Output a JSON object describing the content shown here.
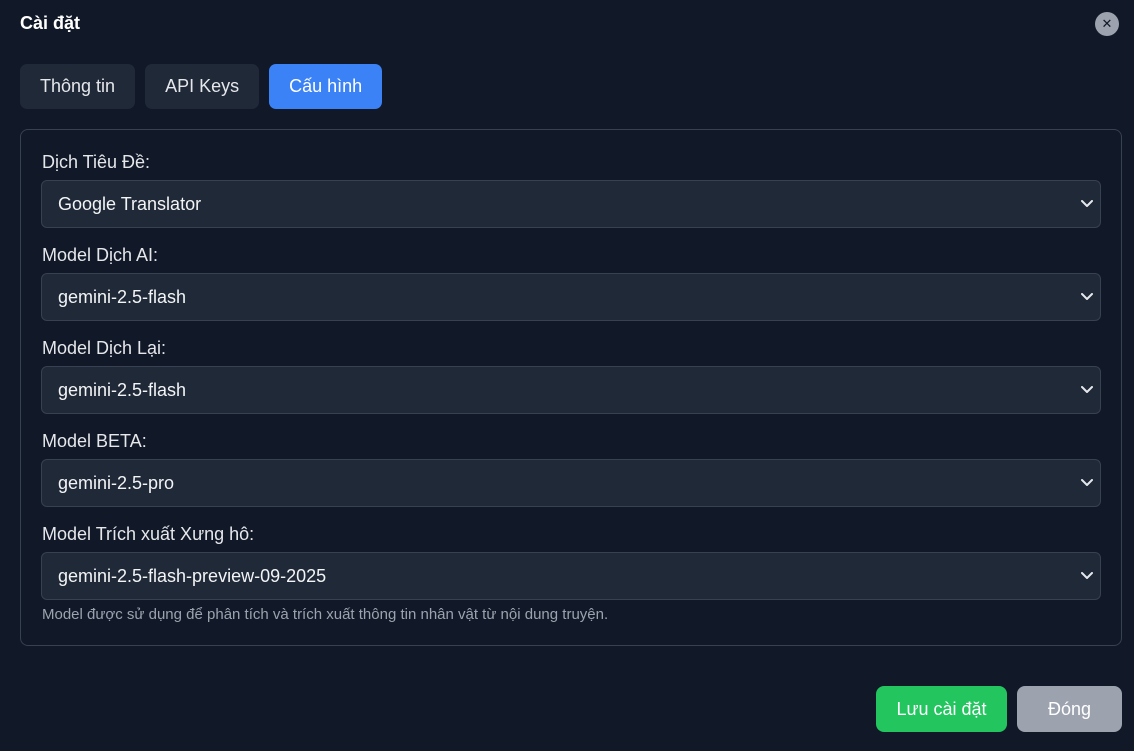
{
  "dialog": {
    "title": "Cài đặt",
    "close_icon": "close-icon"
  },
  "tabs": [
    {
      "label": "Thông tin",
      "active": false
    },
    {
      "label": "API Keys",
      "active": false
    },
    {
      "label": "Cấu hình",
      "active": true
    }
  ],
  "fields": [
    {
      "label": "Dịch Tiêu Đề:",
      "value": "Google Translator"
    },
    {
      "label": "Model Dịch AI:",
      "value": "gemini-2.5-flash"
    },
    {
      "label": "Model Dịch Lại:",
      "value": "gemini-2.5-flash"
    },
    {
      "label": "Model BETA:",
      "value": "gemini-2.5-pro"
    },
    {
      "label": "Model Trích xuất Xưng hô:",
      "value": "gemini-2.5-flash-preview-09-2025"
    }
  ],
  "help_text": "Model được sử dụng để phân tích và trích xuất thông tin nhân vật từ nội dung truyện.",
  "buttons": {
    "save_label": "Lưu cài đặt",
    "close_label": "Đóng"
  },
  "colors": {
    "background": "#111827",
    "accent": "#3b82f6",
    "save": "#22c55e",
    "secondary": "#9ca3af"
  }
}
